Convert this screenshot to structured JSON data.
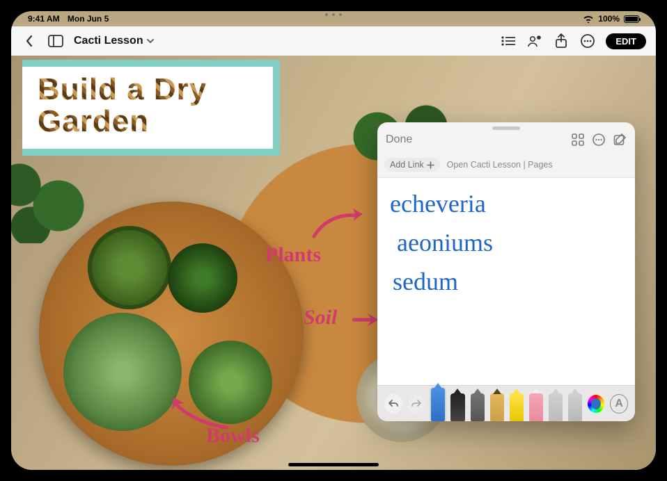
{
  "status": {
    "time": "9:41 AM",
    "date": "Mon Jun 5",
    "battery_pct": "100%"
  },
  "toolbar": {
    "doc_title": "Cacti Lesson",
    "edit_label": "EDIT"
  },
  "document": {
    "title_text": "Build a Dry Garden",
    "annotations": {
      "plants": "Plants",
      "soil": "Soil",
      "bowls": "Bowls"
    }
  },
  "quicknote": {
    "done_label": "Done",
    "add_link_label": "Add Link",
    "context_link": "Open Cacti Lesson | Pages",
    "handwriting_lines": [
      "echeveria",
      "aeoniums",
      "sedum"
    ],
    "text_tool_glyph": "A"
  }
}
